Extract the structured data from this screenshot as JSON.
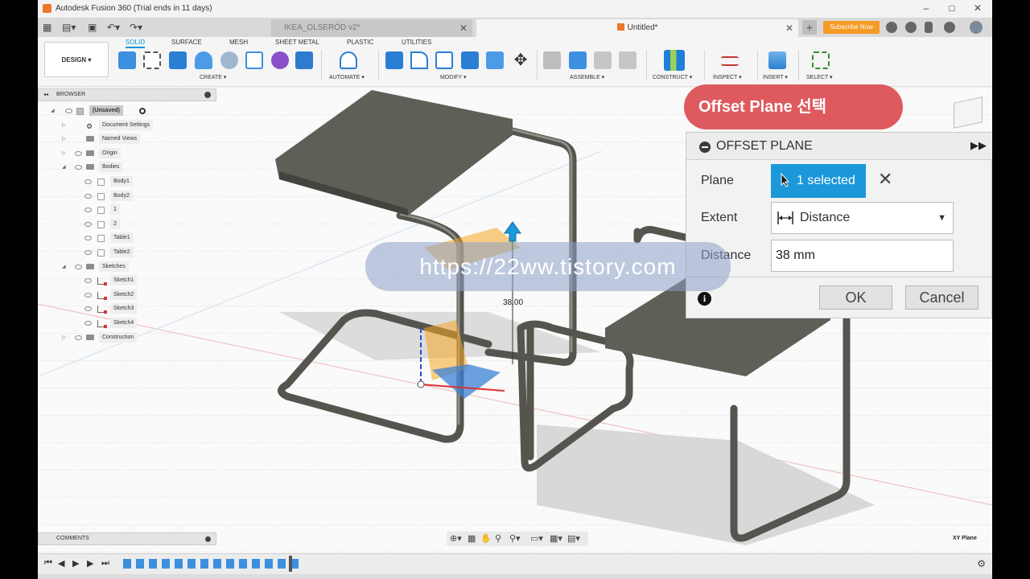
{
  "window": {
    "title": "Autodesk Fusion 360 (Trial ends in 11 days)",
    "controls": [
      "–",
      "□",
      "✕"
    ]
  },
  "tabs": {
    "inactive": {
      "label": "IKEA_OLSERÖD v2*"
    },
    "active": {
      "label": "Untitled*"
    },
    "plus": "+",
    "subscribe": "Subscribe Now"
  },
  "toolbar": {
    "design": "DESIGN ▾",
    "workspace_tabs": [
      "SOLID",
      "SURFACE",
      "MESH",
      "SHEET METAL",
      "PLASTIC",
      "UTILITIES"
    ],
    "groups": [
      "CREATE ▾",
      "AUTOMATE ▾",
      "MODIFY ▾",
      "ASSEMBLE ▾",
      "CONSTRUCT ▾",
      "INSPECT ▾",
      "INSERT ▾",
      "SELECT ▾"
    ]
  },
  "browser": {
    "header": "BROWSER",
    "root": "(Unsaved)",
    "items": [
      {
        "label": "Document Settings",
        "kind": "settings"
      },
      {
        "label": "Named Views",
        "kind": "folder"
      },
      {
        "label": "Origin",
        "kind": "folder"
      },
      {
        "label": "Bodies",
        "kind": "folder"
      },
      {
        "label": "Body1",
        "kind": "body"
      },
      {
        "label": "Body2",
        "kind": "body"
      },
      {
        "label": "1",
        "kind": "body"
      },
      {
        "label": "2",
        "kind": "body"
      },
      {
        "label": "Table1",
        "kind": "body"
      },
      {
        "label": "Table2",
        "kind": "body"
      },
      {
        "label": "Sketches",
        "kind": "folder"
      },
      {
        "label": "Sketch1",
        "kind": "sketch"
      },
      {
        "label": "Sketch2",
        "kind": "sketch"
      },
      {
        "label": "Sketch3",
        "kind": "sketch"
      },
      {
        "label": "Sketch4",
        "kind": "sketch"
      },
      {
        "label": "Construction",
        "kind": "folder"
      }
    ]
  },
  "comments": "COMMENTS",
  "viewport": {
    "dimension": "38.00",
    "plane": "XY Plane",
    "colors": {
      "model": "#6b6a63",
      "plane_preview": "#f5a623",
      "plane_blue": "#3b82d6"
    }
  },
  "banner": "Offset Plane 선택",
  "dialog": {
    "title": "OFFSET PLANE",
    "plane_label": "Plane",
    "plane_value": "1 selected",
    "extent_label": "Extent",
    "extent_value": "Distance",
    "distance_label": "Distance",
    "distance_value": "38 mm",
    "ok": "OK",
    "cancel": "Cancel"
  },
  "watermark": "https://22ww.tistory.com"
}
